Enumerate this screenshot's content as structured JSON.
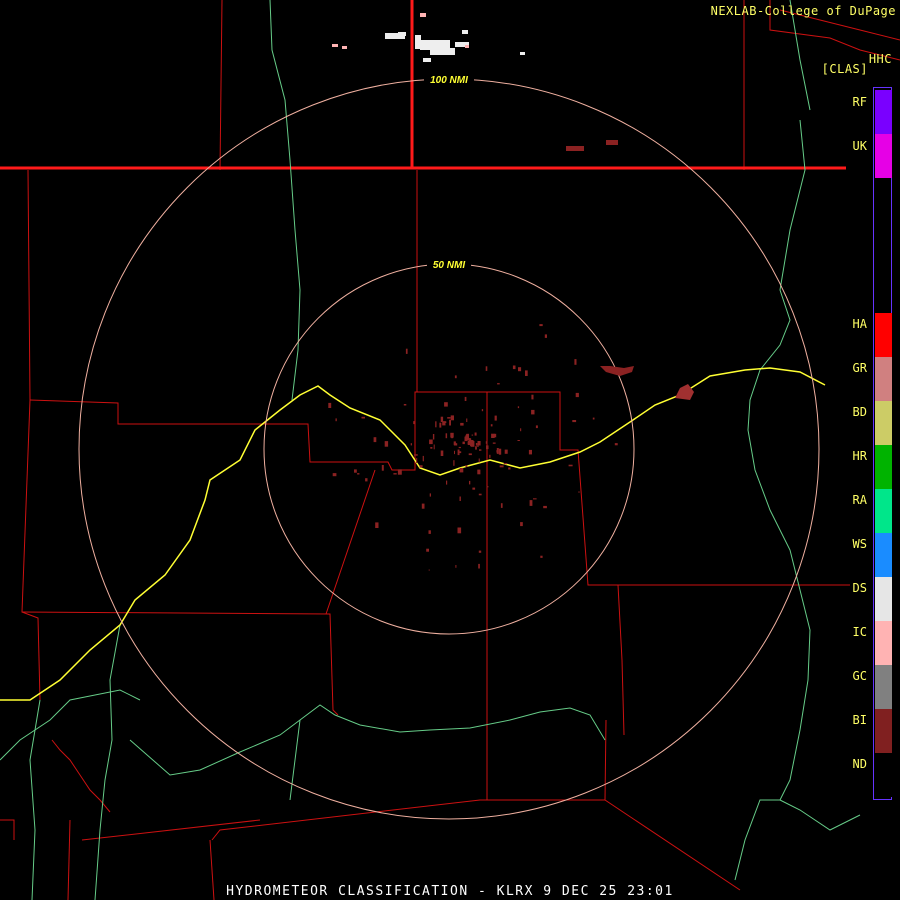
{
  "header": {
    "credit": "NEXLAB-College of DuPage",
    "site_id": "HHC",
    "product_code": "[CLAS]"
  },
  "range_rings": [
    {
      "label": "100 NMI"
    },
    {
      "label": "50 NMI"
    }
  ],
  "legend": [
    {
      "code": "RF",
      "color": "#7a00ff"
    },
    {
      "code": "UK",
      "color": "#e600e6"
    },
    {
      "code": "HA",
      "color": "#ff0000"
    },
    {
      "code": "GR",
      "color": "#d08080"
    },
    {
      "code": "BD",
      "color": "#cccc66"
    },
    {
      "code": "HR",
      "color": "#00b300"
    },
    {
      "code": "RA",
      "color": "#00e68a"
    },
    {
      "code": "WS",
      "color": "#1a8cff"
    },
    {
      "code": "DS",
      "color": "#e6e6e6"
    },
    {
      "code": "IC",
      "color": "#ffb3b3"
    },
    {
      "code": "GC",
      "color": "#808080"
    },
    {
      "code": "BI",
      "color": "#802020"
    },
    {
      "code": "ND",
      "color": "#000000"
    }
  ],
  "caption": "HYDROMETEOR CLASSIFICATION - KLRX 9 DEC 25 23:01",
  "colors": {
    "ring": "#f0b0a0",
    "ring_label": "#ffff33",
    "county_line": "#cc1111",
    "state_line": "#ff1a1a",
    "road": "#66cc88",
    "interstate": "#ffff33",
    "echo": "#8b2222",
    "snow": "#eeeeee"
  }
}
